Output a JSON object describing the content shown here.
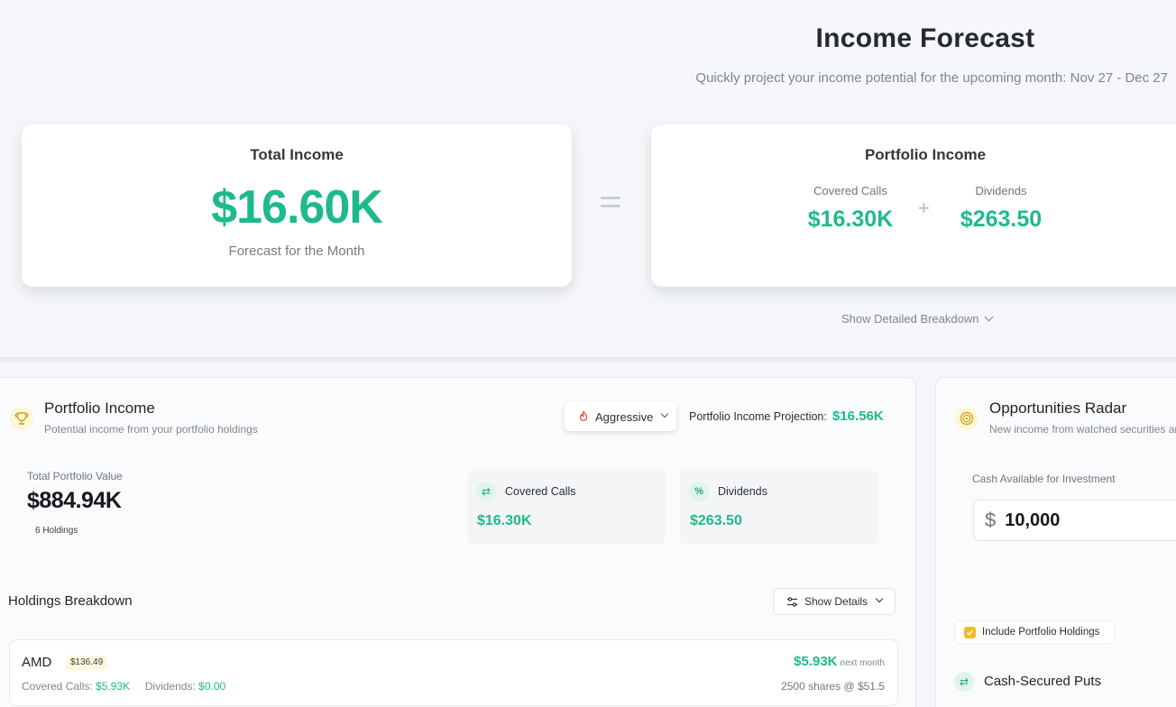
{
  "header": {
    "title": "Income Forecast",
    "subtitle": "Quickly project your income potential for the upcoming month: Nov 27 - Dec 27"
  },
  "total_card": {
    "title": "Total Income",
    "value": "$16.60K",
    "note": "Forecast for the Month"
  },
  "portfolio_card": {
    "title": "Portfolio Income",
    "covered_calls_label": "Covered Calls",
    "covered_calls_value": "$16.30K",
    "dividends_label": "Dividends",
    "dividends_value": "$263.50"
  },
  "breakdown_link": "Show Detailed Breakdown",
  "portfolio_panel": {
    "title": "Portfolio Income",
    "subtitle": "Potential income from your portfolio holdings",
    "strategy": "Aggressive",
    "projection_label": "Portfolio Income Projection:",
    "projection_value": "$16.56K",
    "total_value_label": "Total Portfolio Value",
    "total_value": "$884.94K",
    "holdings_count": "6 Holdings",
    "metrics": [
      {
        "label": "Covered Calls",
        "value": "$16.30K",
        "icon": "swap-icon"
      },
      {
        "label": "Dividends",
        "value": "$263.50",
        "icon": "percent-icon"
      }
    ],
    "holdings_title": "Holdings Breakdown",
    "show_details": "Show Details",
    "holdings": [
      {
        "ticker": "AMD",
        "price": "$136.49",
        "covered_calls_label": "Covered Calls:",
        "covered_calls": "$5.93K",
        "dividends_label": "Dividends:",
        "dividends": "$0.00",
        "income": "$5.93K",
        "income_note": "next month",
        "shares": "2500 shares @ $51.5"
      }
    ]
  },
  "radar_panel": {
    "title": "Opportunities Radar",
    "subtitle": "New income from watched securities ar",
    "cash_label": "Cash Available for Investment",
    "cash_value": "10,000",
    "include_label": "Include Portfolio Holdings",
    "csp_title": "Cash-Secured Puts"
  },
  "colors": {
    "accent_green": "#1fba8a",
    "badge_yellow": "#fdf7dd",
    "checkbox_yellow": "#f2b92a"
  }
}
